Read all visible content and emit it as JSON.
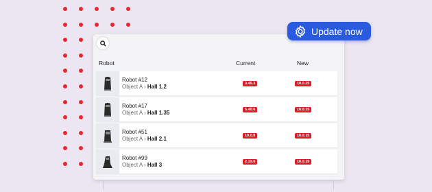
{
  "update_button": {
    "label": "Update now",
    "icon": "gear-icon"
  },
  "table": {
    "headers": {
      "robot": "Robot",
      "current": "Current",
      "new": "New"
    },
    "rows": [
      {
        "name": "Robot #12",
        "object": "Object A",
        "hall": "Hall 1.2",
        "current": "3.45.3",
        "new": "10.0.15"
      },
      {
        "name": "Robot #17",
        "object": "Object A",
        "hall": "Hall 1.35",
        "current": "5.40.6",
        "new": "10.0.15"
      },
      {
        "name": "Robot #51",
        "object": "Object A",
        "hall": "Hall 2.1",
        "current": "10.0.8",
        "new": "10.0.15"
      },
      {
        "name": "Robot #99",
        "object": "Object A",
        "hall": "Hall 3",
        "current": "2.19.6",
        "new": "10.0.15"
      }
    ]
  },
  "colors": {
    "accent": "#2a5bdf",
    "badge": "#d81e26",
    "dots": "#e8262f"
  }
}
